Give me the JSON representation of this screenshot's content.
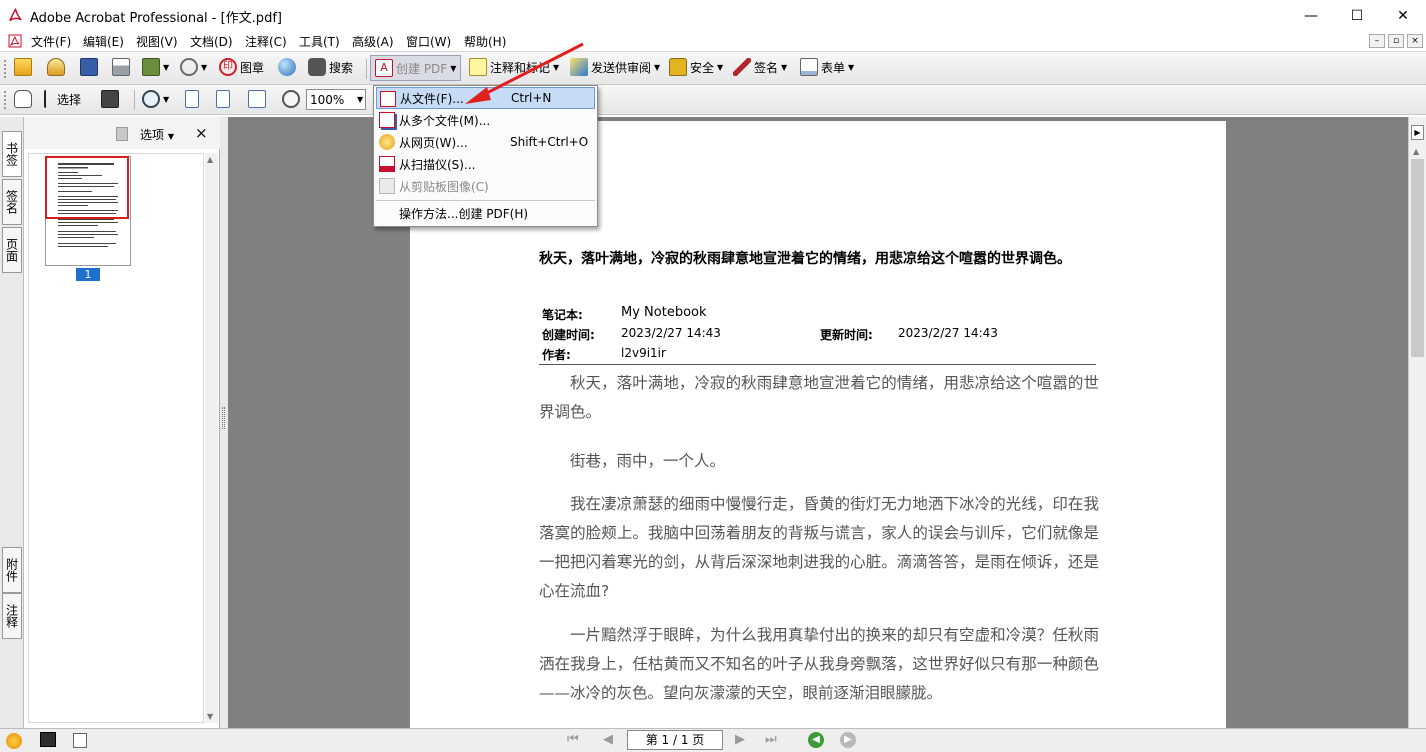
{
  "window": {
    "title": "Adobe Acrobat Professional - [作文.pdf]",
    "minimize": "—",
    "maximize": "☐",
    "close": "✕"
  },
  "menubar": {
    "items": [
      "文件(F)",
      "编辑(E)",
      "视图(V)",
      "文档(D)",
      "注释(C)",
      "工具(T)",
      "高级(A)",
      "窗口(W)",
      "帮助(H)"
    ],
    "mdi": {
      "minimize": "–",
      "restore": "▫",
      "close": "×"
    }
  },
  "toolbar1": {
    "stamp": "图章",
    "search": "搜索",
    "create_pdf": "创建 PDF",
    "comment": "注释和标记",
    "review": "发送供审阅",
    "security": "安全",
    "sign": "签名",
    "forms": "表单"
  },
  "toolbar2": {
    "select": "选择",
    "zoom": "100%"
  },
  "create_menu": {
    "items": [
      {
        "label": "从文件(F)...",
        "shortcut": "Ctrl+N"
      },
      {
        "label": "从多个文件(M)...",
        "shortcut": ""
      },
      {
        "label": "从网页(W)...",
        "shortcut": "Shift+Ctrl+O"
      },
      {
        "label": "从扫描仪(S)...",
        "shortcut": ""
      },
      {
        "label": "从剪贴板图像(C)",
        "shortcut": ""
      },
      {
        "label": "操作方法...创建 PDF(H)",
        "shortcut": ""
      }
    ]
  },
  "left_tabs": {
    "bookmarks": "书签",
    "signatures": "签名",
    "pages": "页面",
    "attachments": "附件",
    "comments": "注释"
  },
  "pages_panel": {
    "options": "选项",
    "close": "×",
    "page_number": "1"
  },
  "document": {
    "title": "秋天，落叶满地，冷寂的秋雨肆意地宣泄着它的情绪，用悲凉给这个喧嚣的世界调色。",
    "meta": {
      "notebook_label": "笔记本:",
      "notebook": "My Notebook",
      "created_label": "创建时间:",
      "created": "2023/2/27 14:43",
      "updated_label": "更新时间:",
      "updated": "2023/2/27 14:43",
      "author_label": "作者:",
      "author": "l2v9i1ir"
    },
    "paragraphs": [
      "秋天，落叶满地，冷寂的秋雨肆意地宣泄着它的情绪，用悲凉给这个喧嚣的世界调色。",
      "街巷，雨中，一个人。",
      "我在凄凉萧瑟的细雨中慢慢行走，昏黄的街灯无力地洒下冰冷的光线，印在我落寞的脸颊上。我脑中回荡着朋友的背叛与谎言，家人的误会与训斥，它们就像是一把把闪着寒光的剑，从背后深深地刺进我的心脏。滴滴答答，是雨在倾诉，还是心在流血?",
      "一片黯然浮于眼眸，为什么我用真挚付出的换来的却只有空虚和冷漠？任秋雨洒在我身上，任枯黄而又不知名的叶子从我身旁飘落，这世界好似只有那一种颜色——冰冷的灰色。望向灰濛濛的天空，眼前逐渐泪眼朦胧。"
    ]
  },
  "statusbar": {
    "page_indicator": "第 1 / 1 页"
  }
}
